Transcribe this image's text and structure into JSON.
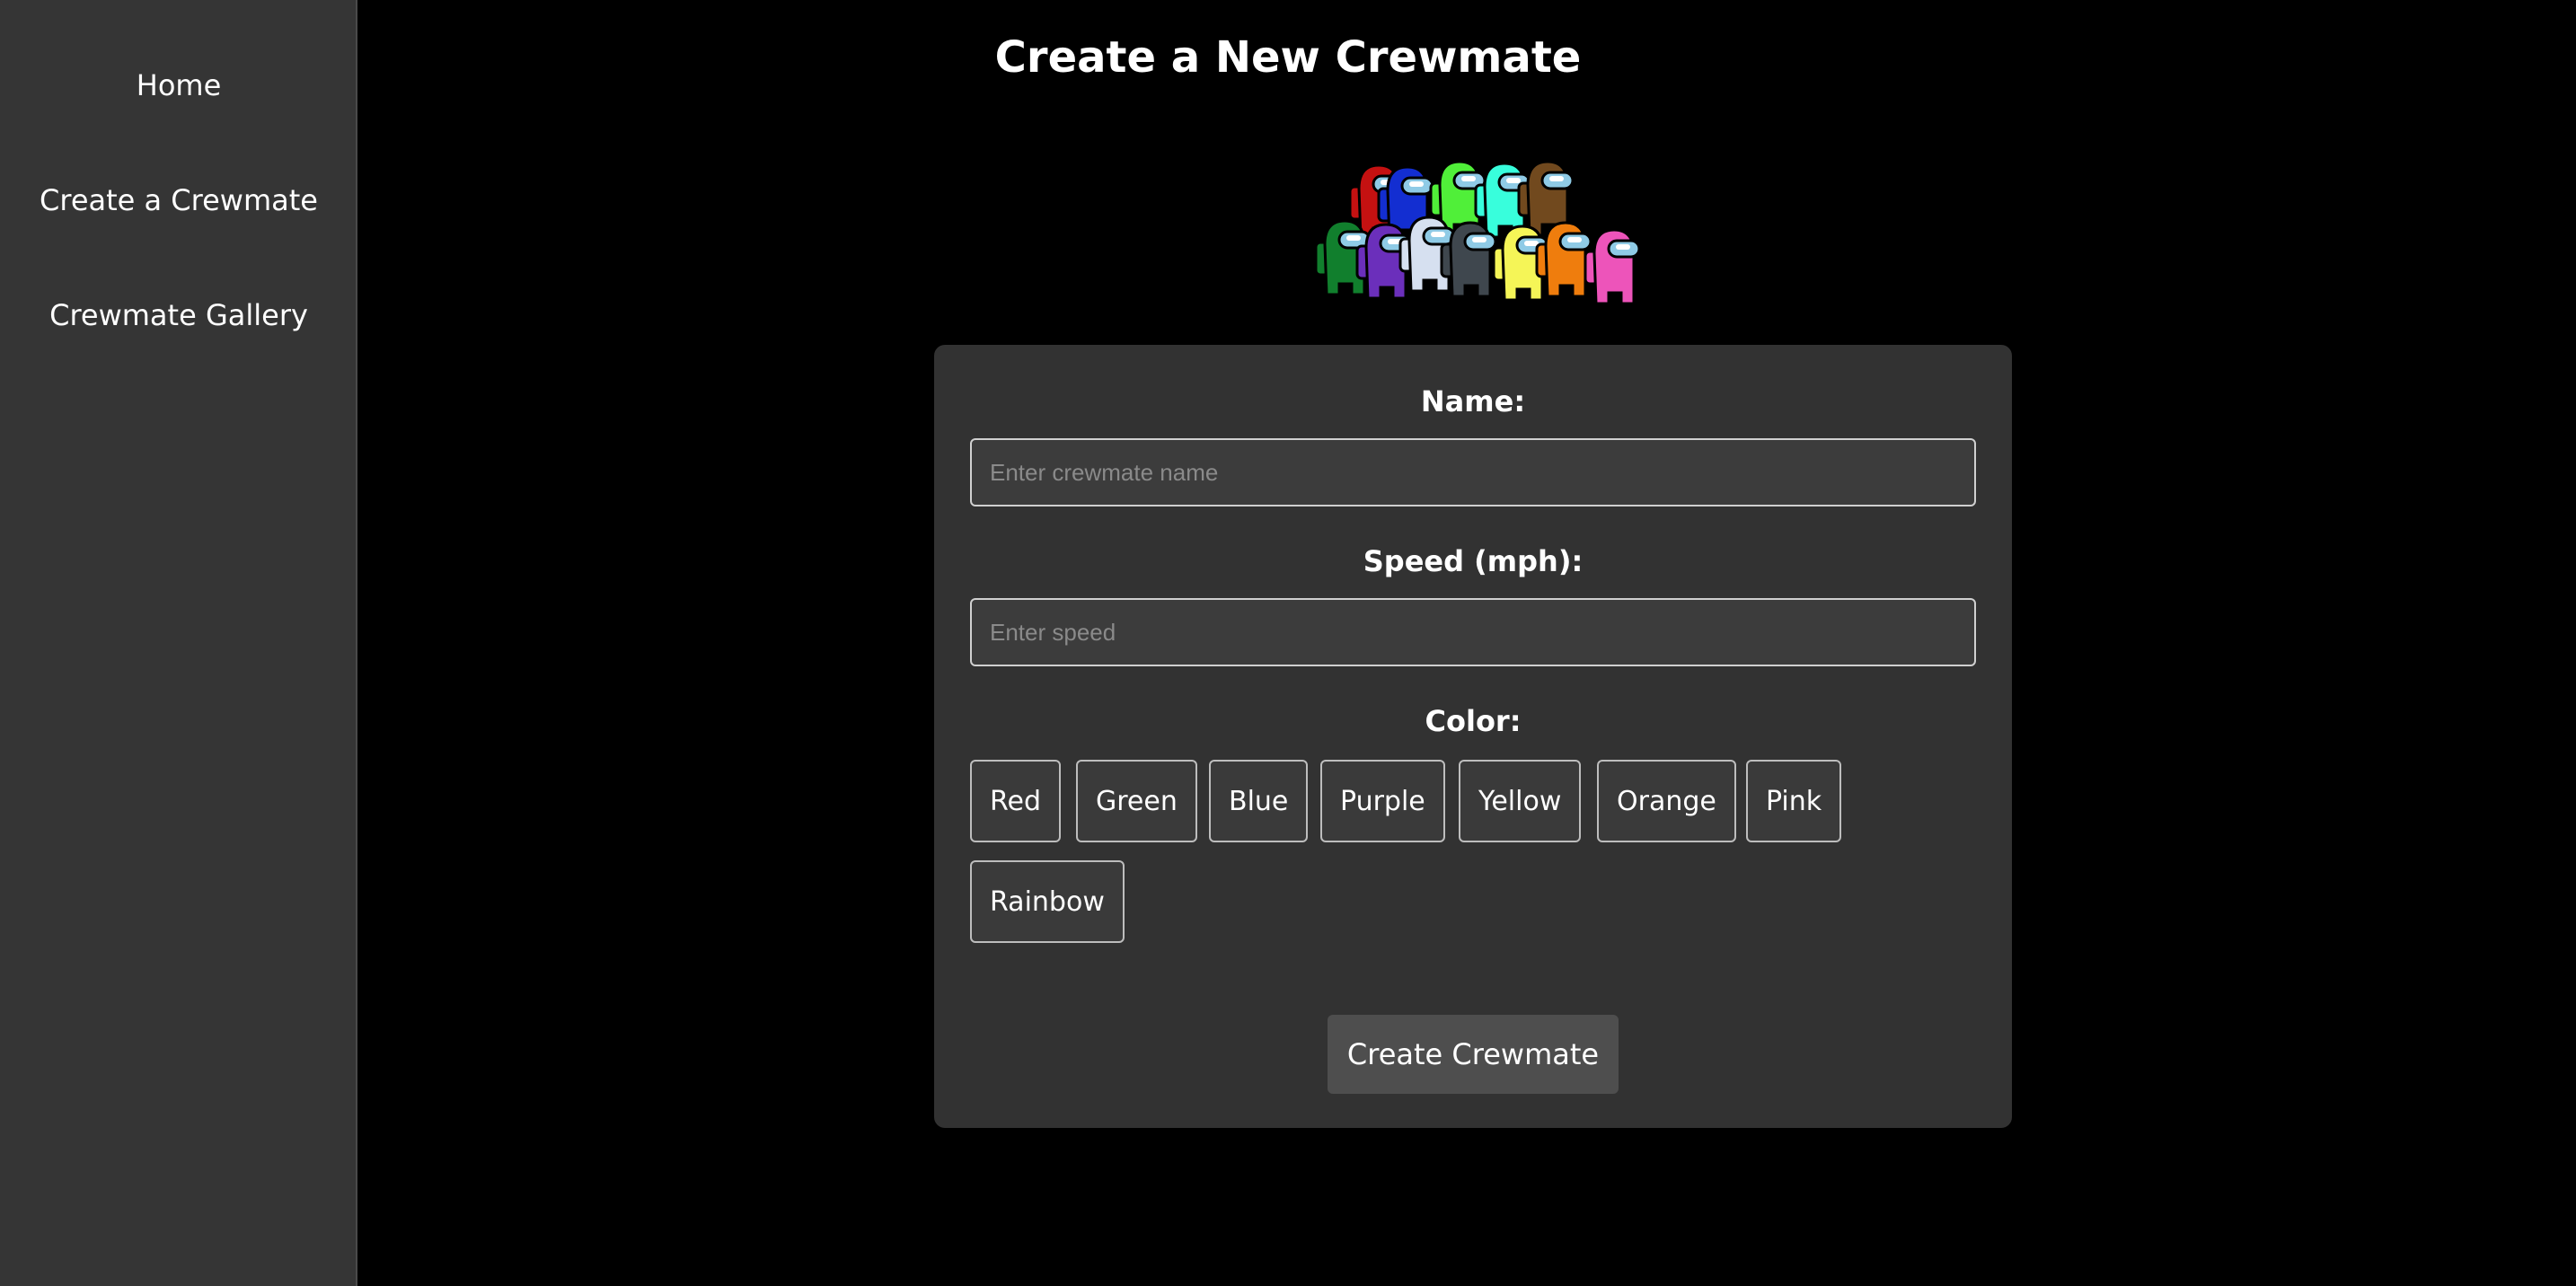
{
  "sidebar": {
    "items": [
      {
        "label": "Home"
      },
      {
        "label": "Create a Crewmate"
      },
      {
        "label": "Crewmate Gallery"
      }
    ]
  },
  "page": {
    "title": "Create a New Crewmate"
  },
  "form": {
    "name_label": "Name:",
    "name_placeholder": "Enter crewmate name",
    "speed_label": "Speed (mph):",
    "speed_placeholder": "Enter speed",
    "color_label": "Color:",
    "colors": [
      "Red",
      "Green",
      "Blue",
      "Purple",
      "Yellow",
      "Orange",
      "Pink",
      "Rainbow"
    ],
    "submit_label": "Create Crewmate"
  },
  "crewmate_image": {
    "icon": "crewmate-group-icon",
    "colors": [
      "#c51111",
      "#132ed1",
      "#50ef39",
      "#38fedc",
      "#71491e",
      "#117f2d",
      "#6b2fbb",
      "#d6e0f0",
      "#3f474e",
      "#f5f557",
      "#ef7d0d",
      "#ed54ba"
    ]
  },
  "theme": {
    "background": "#000000",
    "sidebar": "#353535",
    "card": "#323232",
    "button": "#4e4e4e"
  }
}
